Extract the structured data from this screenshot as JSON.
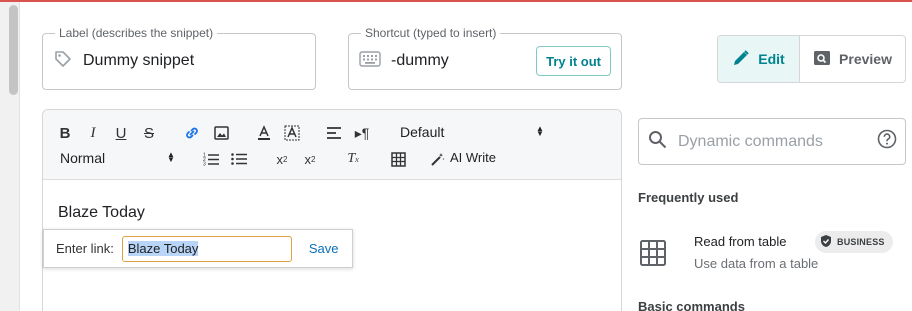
{
  "label_field": {
    "legend": "Label (describes the snippet)",
    "value": "Dummy snippet",
    "icon": "tag-icon"
  },
  "shortcut_field": {
    "legend": "Shortcut (typed to insert)",
    "value": "-dummy",
    "icon": "keyboard-icon",
    "try_button": "Try it out"
  },
  "mode_toggle": {
    "edit": "Edit",
    "preview": "Preview",
    "active": "edit"
  },
  "toolbar": {
    "font_select": "Default",
    "block_select": "Normal",
    "ai_write": "AI Write"
  },
  "editor": {
    "content": "Blaze Today"
  },
  "link_popup": {
    "label": "Enter link:",
    "value": "Blaze Today",
    "save": "Save"
  },
  "sidebar": {
    "search_placeholder": "Dynamic commands",
    "frequently_used_title": "Frequently used",
    "frequent_items": [
      {
        "title": "Read from table",
        "description": "Use data from a table",
        "badge": "BUSINESS",
        "icon": "table-grid-icon"
      }
    ],
    "basic_commands_title": "Basic commands"
  },
  "colors": {
    "accent": "#00838f",
    "top_border": "#d9534f",
    "link_blue": "#0b6fb8"
  }
}
